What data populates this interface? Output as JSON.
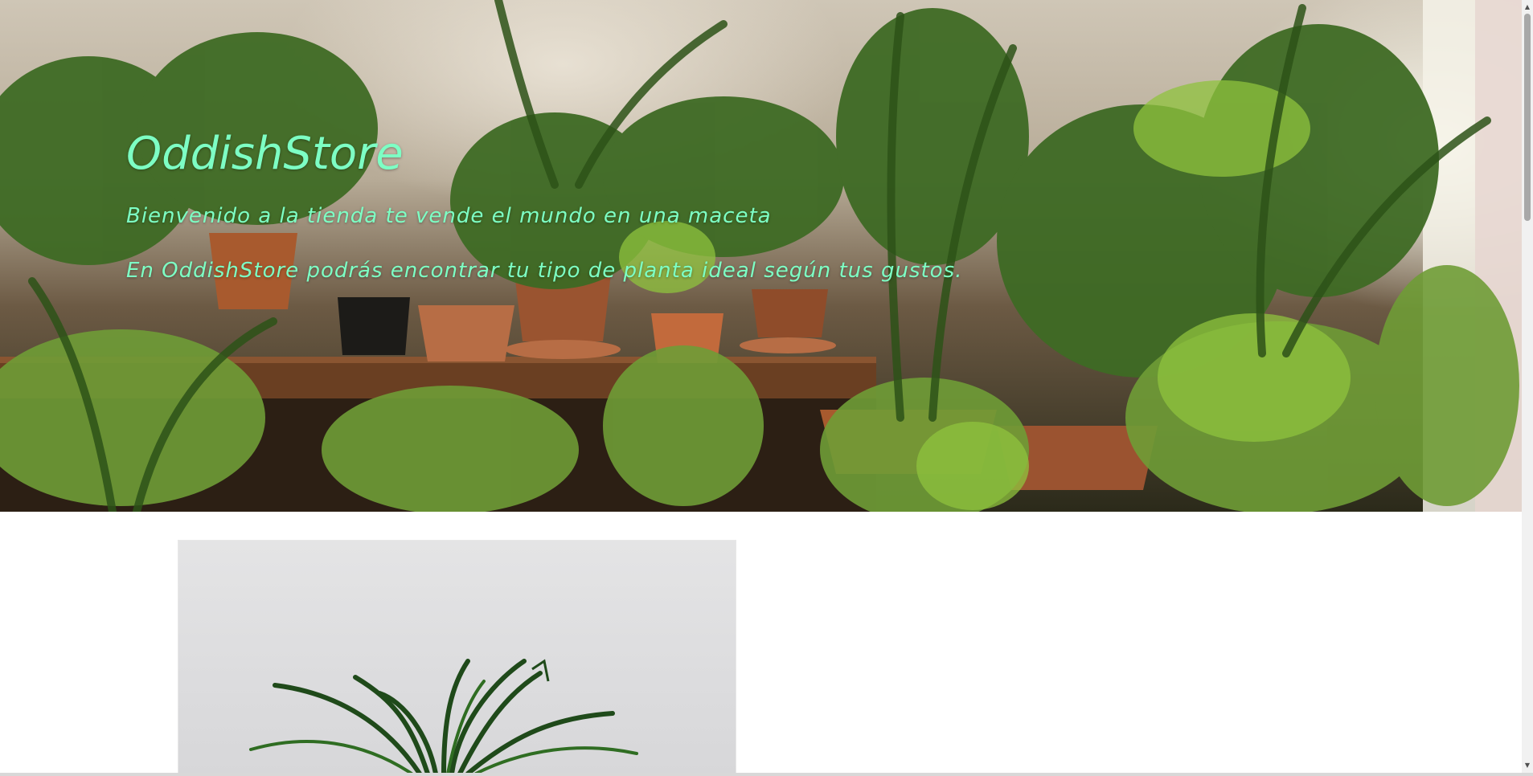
{
  "hero": {
    "title": "OddishStore",
    "line1": "Bienvenido a la tienda te vende el mundo en una maceta",
    "line2": "En OddishStore podrás encontrar tu tipo de planta ideal según tus gustos."
  },
  "colors": {
    "hero_text": "#7dffc4",
    "page_background": "#ffffff",
    "scrollbar_thumb": "#a8a8a8"
  },
  "icons": {
    "scroll_up": "triangle-up",
    "scroll_down": "triangle-down"
  }
}
